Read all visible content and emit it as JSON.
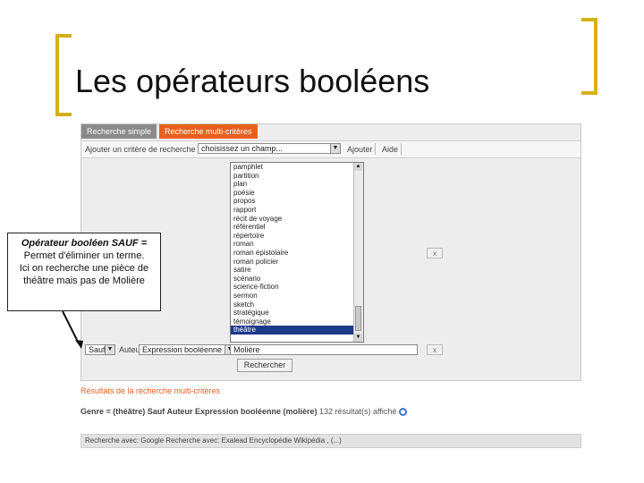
{
  "slide": {
    "title": "Les opérateurs booléens"
  },
  "tabs": [
    {
      "label": "Recherche simple"
    },
    {
      "label": "Recherche multi-critères"
    }
  ],
  "toolbar": {
    "add_label": "Ajouter un critère de recherche sur",
    "field_select_value": "choisissez un champ...",
    "add_button": "Ajouter",
    "help_button": "Aide"
  },
  "listbox": {
    "items": [
      "pamphlet",
      "partition",
      "plan",
      "poésie",
      "propos",
      "rapport",
      "récit de voyage",
      "référentiel",
      "répertoire",
      "roman",
      "roman épistolaire",
      "roman policier",
      "satire",
      "scénario",
      "science-fiction",
      "sermon",
      "sketch",
      "stratégique",
      "témoignage",
      "théâtre"
    ],
    "selected_index": 19
  },
  "criterion": {
    "operator_value": "Sauf",
    "field_label": "Auteur",
    "mode_value": "Expression booléenne",
    "term_value": "Molière",
    "remove_glyph": "x"
  },
  "search_button": "Rechercher",
  "callout": {
    "heading": "Opérateur booléen SAUF =",
    "lines": [
      "Permet d'éliminer un terme.",
      "Ici on recherche une pièce de",
      "théâtre mais pas de Molière"
    ]
  },
  "results": {
    "link": "Résultats de la recherche multi-critères",
    "summary": "Genre = (théâtre) Sauf Auteur Expression booléenne (molière)",
    "count": "132 résultat(s) affiché",
    "icons": {
      "search": "search-icon"
    }
  },
  "footer": {
    "text": "Recherche avec: Google Recherche avec: Exalead Encyclopédie Wikipédia , (...)"
  }
}
